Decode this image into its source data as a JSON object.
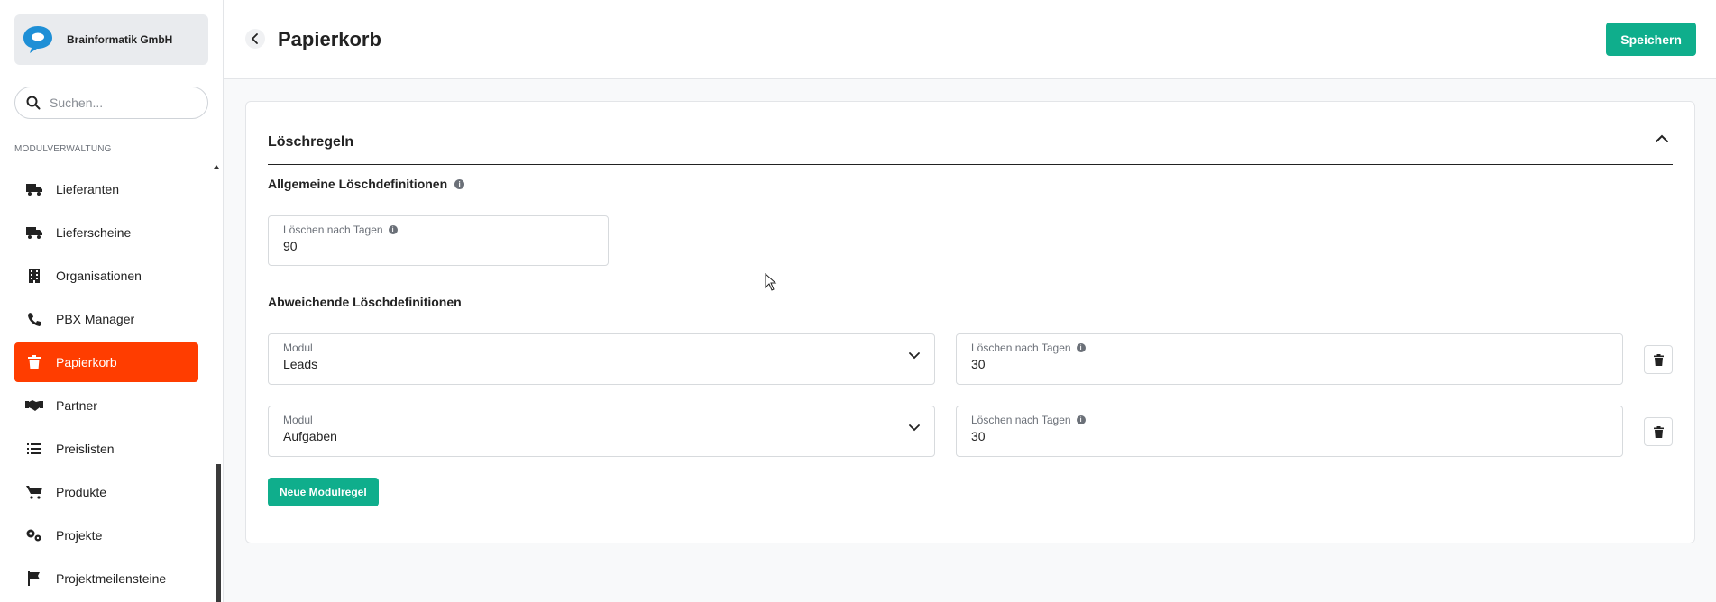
{
  "sidebar": {
    "company_name": "Brainformatik GmbH",
    "search_placeholder": "Suchen...",
    "section_label": "MODULVERWALTUNG",
    "items": [
      {
        "label": "Lieferanten",
        "icon": "truck-icon"
      },
      {
        "label": "Lieferscheine",
        "icon": "truck-icon"
      },
      {
        "label": "Organisationen",
        "icon": "building-icon"
      },
      {
        "label": "PBX Manager",
        "icon": "phone-icon"
      },
      {
        "label": "Papierkorb",
        "icon": "trash-icon",
        "active": true
      },
      {
        "label": "Partner",
        "icon": "handshake-icon"
      },
      {
        "label": "Preislisten",
        "icon": "list-icon"
      },
      {
        "label": "Produkte",
        "icon": "cart-icon"
      },
      {
        "label": "Projekte",
        "icon": "gears-icon"
      },
      {
        "label": "Projektmeilensteine",
        "icon": "flag-icon"
      }
    ]
  },
  "header": {
    "title": "Papierkorb",
    "save_label": "Speichern"
  },
  "card": {
    "title": "Löschregeln",
    "general_heading": "Allgemeine Löschdefinitionen",
    "general_field": {
      "label": "Löschen nach Tagen",
      "value": "90"
    },
    "override_heading": "Abweichende Löschdefinitionen",
    "rules": [
      {
        "module_label": "Modul",
        "module_value": "Leads",
        "days_label": "Löschen nach Tagen",
        "days_value": "30"
      },
      {
        "module_label": "Modul",
        "module_value": "Aufgaben",
        "days_label": "Löschen nach Tagen",
        "days_value": "30"
      }
    ],
    "add_rule_label": "Neue Modulregel"
  },
  "colors": {
    "accent": "#0fae8c",
    "active_nav": "#ff3d00",
    "brand_blue": "#1e8fd6"
  }
}
